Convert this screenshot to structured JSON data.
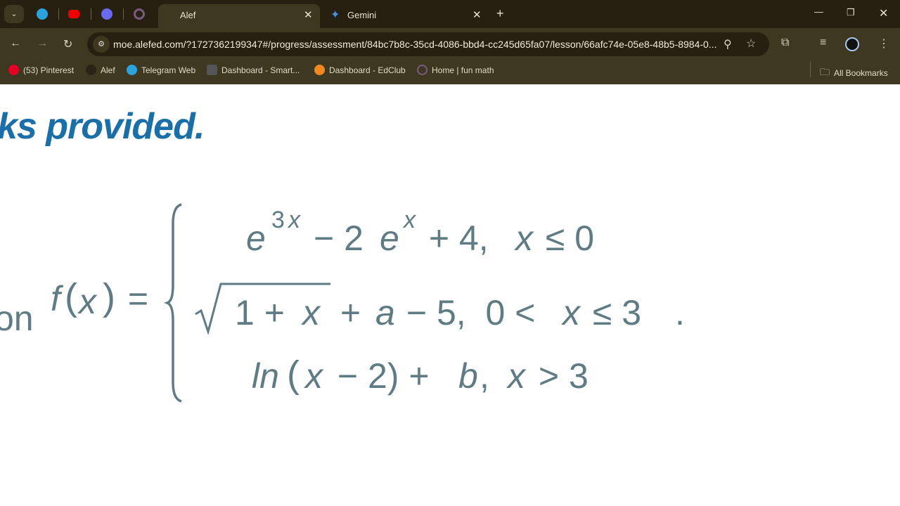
{
  "tabs": [
    {
      "icon": "telegram-icon"
    },
    {
      "icon": "youtube-icon"
    },
    {
      "icon": "q-icon"
    },
    {
      "icon": "circle-icon"
    },
    {
      "label": "Alef",
      "active": true
    },
    {
      "label": "Gemini"
    }
  ],
  "address": "moe.alefed.com/?1727362199347#/progress/assessment/84bc7b8c-35cd-4086-bbd4-cc245d65fa07/lesson/66afc74e-05e8-48b5-8984-0...",
  "bookmarks": [
    "(53) Pinterest",
    "Alef",
    "Telegram Web",
    "Dashboard - Smart...",
    "Dashboard - EdClub",
    "Home | fun math"
  ],
  "all_bookmarks": "All Bookmarks",
  "content": {
    "heading": "ks provided.",
    "prefix": "on",
    "lhs": [
      "f",
      "(",
      "x",
      ")",
      " ="
    ],
    "row1": [
      "e",
      "3",
      "x",
      "− 2 ",
      "e",
      "x",
      " + 4,  ",
      "x",
      " ≤ 0"
    ],
    "row2": [
      "1 + ",
      "x",
      " + ",
      "a",
      " − 5,  0 < ",
      "x",
      " ≤ 3"
    ],
    "row3": [
      "ln",
      "(",
      "x",
      " − 2) + ",
      "b",
      ",  ",
      "x",
      " > 3"
    ],
    "period": "."
  },
  "colors": {
    "math": "#5f7b84",
    "heading": "#1a6fa8",
    "tabbar": "#272010",
    "toolbar": "#3f3820"
  }
}
